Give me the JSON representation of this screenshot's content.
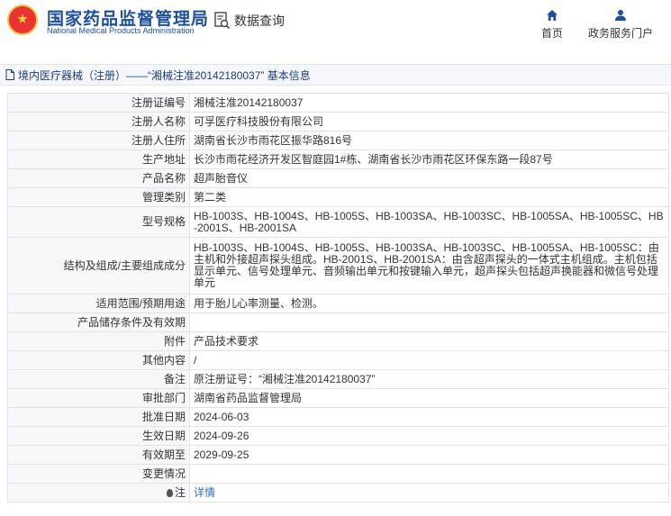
{
  "header": {
    "logo_cn": "国家药品监督管理局",
    "logo_en": "National Medical Products Administration",
    "query_label": "数据查询",
    "nav": [
      {
        "label": "首页",
        "icon": "home-icon"
      },
      {
        "label": "政务服务门户",
        "icon": "user-icon"
      }
    ]
  },
  "breadcrumb": "境内医疗器械（注册）——“湘械注准20142180037” 基本信息",
  "rows": [
    {
      "label": "注册证编号",
      "value": "湘械注准20142180037"
    },
    {
      "label": "注册人名称",
      "value": "可孚医疗科技股份有限公司"
    },
    {
      "label": "注册人住所",
      "value": "湖南省长沙市雨花区振华路816号"
    },
    {
      "label": "生产地址",
      "value": "长沙市雨花经济开发区智庭园1#栋、湖南省长沙市雨花区环保东路一段87号"
    },
    {
      "label": "产品名称",
      "value": "超声胎音仪"
    },
    {
      "label": "管理类别",
      "value": "第二类"
    },
    {
      "label": "型号规格",
      "value": "HB-1003S、HB-1004S、HB-1005S、HB-1003SA、HB-1003SC、HB-1005SA、HB-1005SC、HB-2001S、HB-2001SA"
    },
    {
      "label": "结构及组成/主要组成成分",
      "value": "HB-1003S、HB-1004S、HB-1005S、HB-1003SA、HB-1003SC、HB-1005SA、HB-1005SC：由主机和外接超声探头组成。HB-2001S、HB-2001SA：由含超声探头的一体式主机组成。主机包括显示单元、信号处理单元、音频输出单元和按键输入单元，超声探头包括超声换能器和微信号处理单元"
    },
    {
      "label": "适用范围/预期用途",
      "value": "用于胎儿心率测量、检测。"
    },
    {
      "label": "产品储存条件及有效期",
      "value": ""
    },
    {
      "label": "附件",
      "value": "产品技术要求"
    },
    {
      "label": "其他内容",
      "value": "/"
    },
    {
      "label": "备注",
      "value": "原注册证号：“湘械注准20142180037”"
    },
    {
      "label": "审批部门",
      "value": "湖南省药品监督管理局"
    },
    {
      "label": "批准日期",
      "value": "2024-06-03"
    },
    {
      "label": "生效日期",
      "value": "2024-09-26"
    },
    {
      "label": "有效期至",
      "value": "2029-09-25"
    },
    {
      "label": "变更情况",
      "value": ""
    }
  ],
  "note": {
    "label": "注",
    "link": "详情"
  }
}
